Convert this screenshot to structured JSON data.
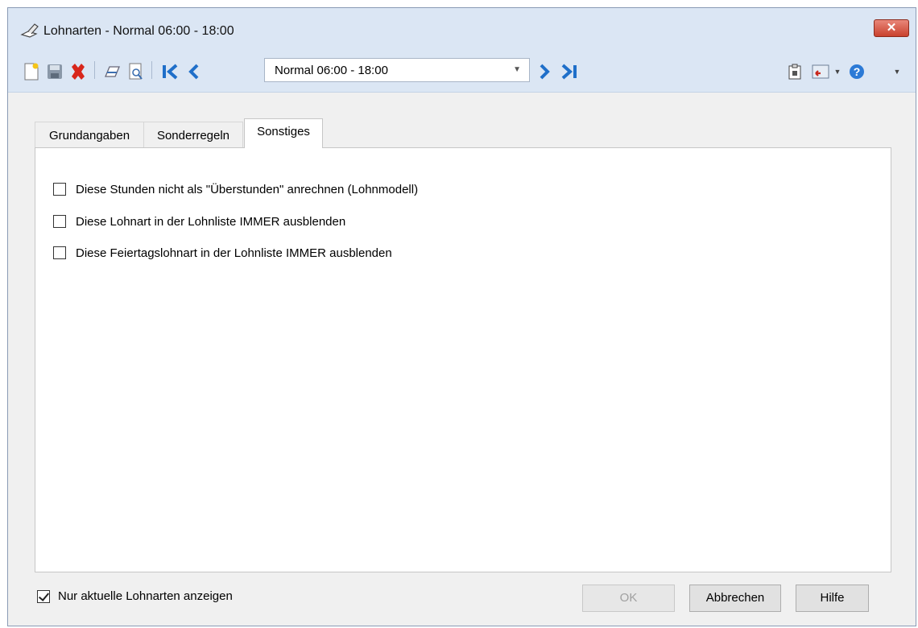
{
  "window": {
    "title": "Lohnarten - Normal 06:00 - 18:00",
    "close_glyph": "✕"
  },
  "toolbar": {
    "record_select": "Normal 06:00 - 18:00",
    "icons": [
      "new-document-icon",
      "save-icon",
      "delete-icon",
      "print-icon",
      "print-preview-icon",
      "first-record-icon",
      "previous-record-icon",
      "next-record-icon",
      "last-record-icon",
      "clipboard-icon",
      "export-icon",
      "help-icon"
    ]
  },
  "tabs": [
    {
      "label": "Grundangaben",
      "active": false
    },
    {
      "label": "Sonderregeln",
      "active": false
    },
    {
      "label": "Sonstiges",
      "active": true
    }
  ],
  "options": [
    {
      "label": "Diese Stunden nicht als \"Überstunden\" anrechnen (Lohnmodell)",
      "checked": false
    },
    {
      "label": "Diese Lohnart in der Lohnliste IMMER ausblenden",
      "checked": false
    },
    {
      "label": "Diese Feiertagslohnart in der Lohnliste IMMER ausblenden",
      "checked": false
    }
  ],
  "footer": {
    "current_only_label": "Nur aktuelle Lohnarten anzeigen",
    "current_only_checked": true,
    "ok_label": "OK",
    "cancel_label": "Abbrechen",
    "help_label": "Hilfe"
  },
  "colors": {
    "titlebar": "#dbe6f4",
    "client": "#f0f0f0",
    "close_button": "#c9412d",
    "nav_arrows": "#1f6fc9"
  }
}
